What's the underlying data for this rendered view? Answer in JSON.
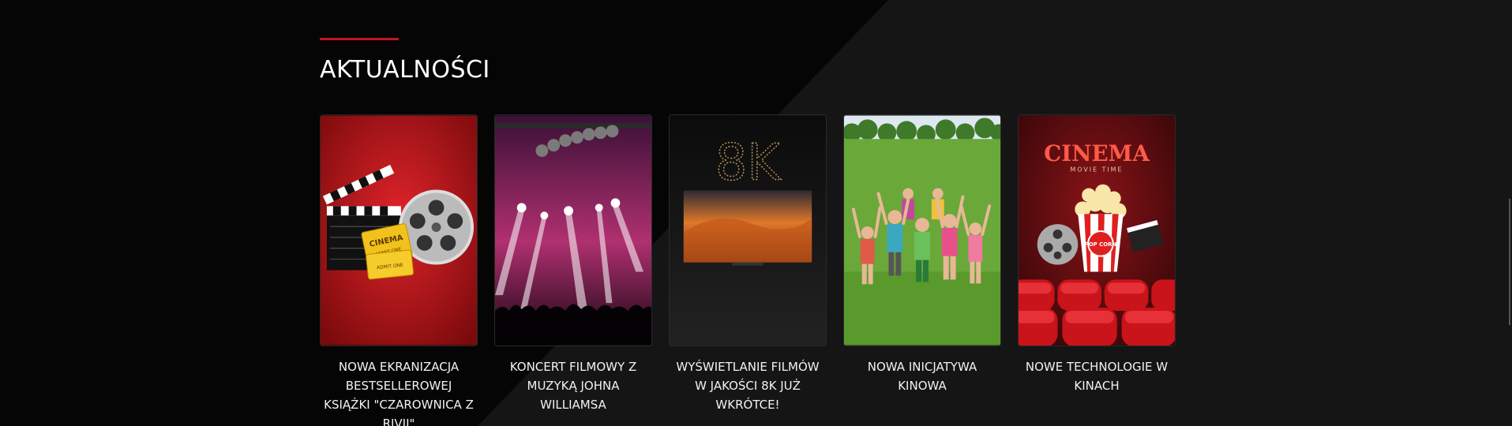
{
  "section": {
    "title": "AKTUALNOŚCI",
    "accent_color": "#c4161c"
  },
  "news": [
    {
      "title": "NOWA EKRANIZACJA BESTSELLEROWEJ KSIĄŻKI \"CZAROWNICA Z RIVII\"",
      "image": "film-reel-clapper-image"
    },
    {
      "title": "KONCERT FILMOWY Z MUZYKĄ JOHNA WILLIAMSA",
      "image": "concert-stage-image"
    },
    {
      "title": "WYŚWIETLANIE FILMÓW W JAKOŚCI 8K JUŻ WKRÓTCE!",
      "image": "8k-tv-image"
    },
    {
      "title": "NOWA INICJATYWA KINOWA",
      "image": "children-meadow-image"
    },
    {
      "title": "NOWE TECHNOLOGIE W KINACH",
      "image": "cinema-popcorn-image"
    }
  ],
  "images": {
    "eight_k_text": "8K",
    "cinema_title": "CINEMA",
    "cinema_subtitle": "MOVIE TIME",
    "popcorn_text": "POP CORN",
    "ticket_text": "CINEMA",
    "ticket_sub": "ADMIT ONE"
  }
}
